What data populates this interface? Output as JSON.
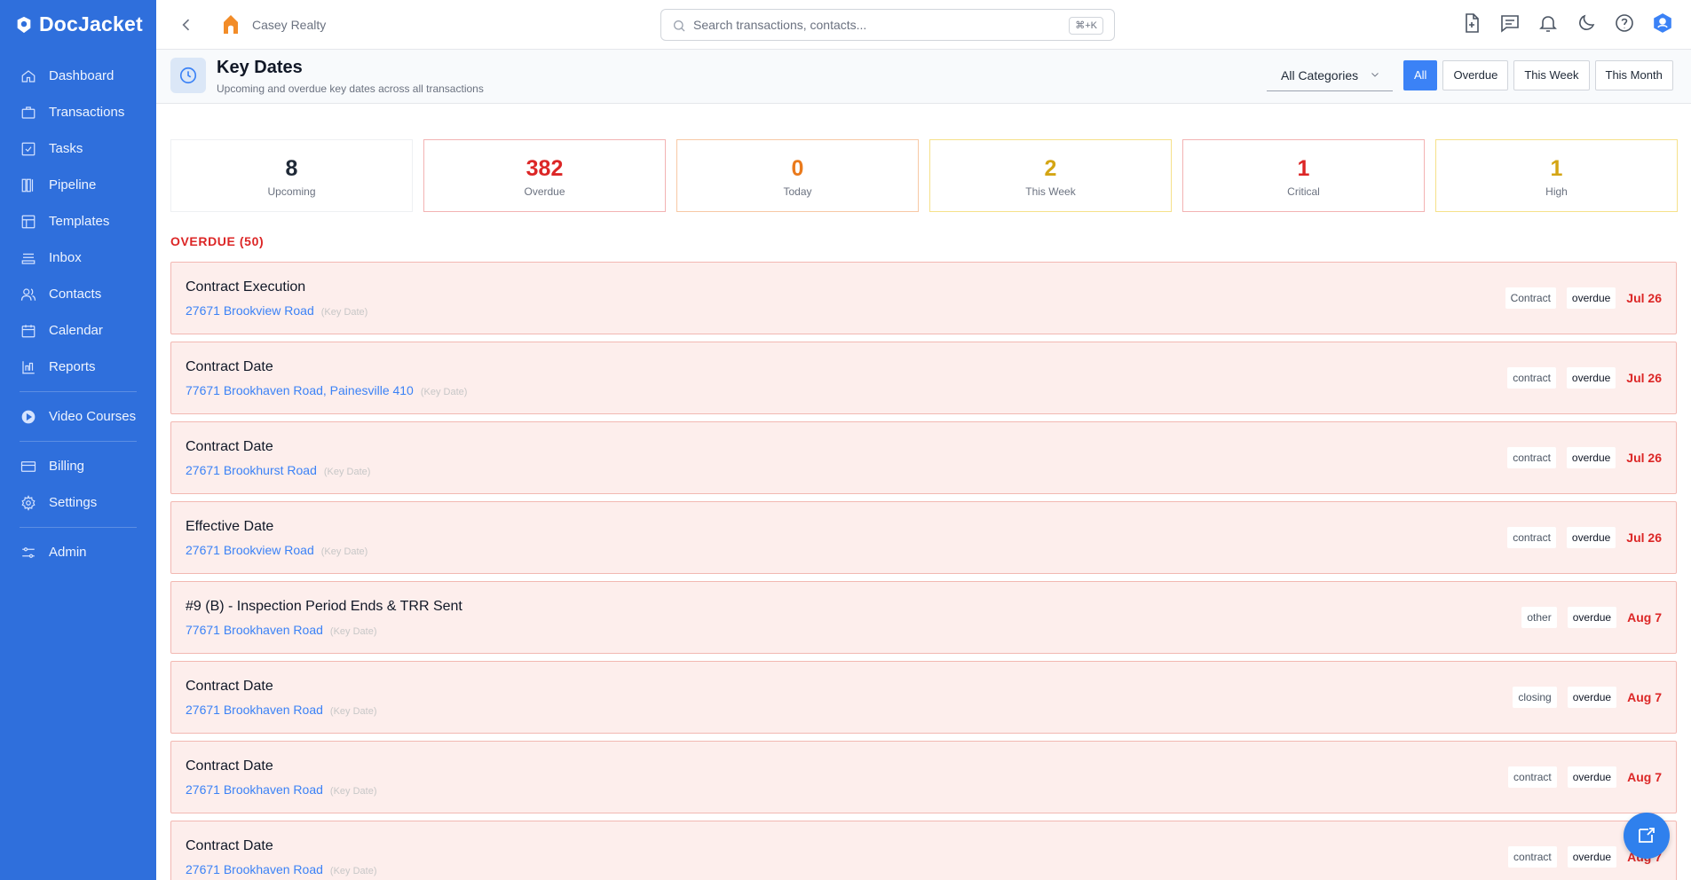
{
  "brand": {
    "name": "DocJacket"
  },
  "sidebar": {
    "items": [
      {
        "label": "Dashboard",
        "icon": "home-icon"
      },
      {
        "label": "Transactions",
        "icon": "briefcase-icon"
      },
      {
        "label": "Tasks",
        "icon": "check-square-icon"
      },
      {
        "label": "Pipeline",
        "icon": "columns-icon"
      },
      {
        "label": "Templates",
        "icon": "template-icon"
      },
      {
        "label": "Inbox",
        "icon": "inbox-icon"
      },
      {
        "label": "Contacts",
        "icon": "users-icon"
      },
      {
        "label": "Calendar",
        "icon": "calendar-icon"
      },
      {
        "label": "Reports",
        "icon": "bar-chart-icon"
      },
      {
        "label": "Video Courses",
        "icon": "play-circle-icon"
      },
      {
        "label": "Billing",
        "icon": "credit-card-icon"
      },
      {
        "label": "Settings",
        "icon": "gear-icon"
      },
      {
        "label": "Admin",
        "icon": "sliders-icon"
      }
    ]
  },
  "topbar": {
    "org_name": "Casey Realty",
    "search_placeholder": "Search transactions, contacts...",
    "search_shortcut": "⌘+K"
  },
  "header": {
    "title": "Key Dates",
    "subtitle": "Upcoming and overdue key dates across all transactions",
    "category_select": "All Categories",
    "filters": [
      "All",
      "Overdue",
      "This Week",
      "This Month"
    ],
    "active_filter": "All"
  },
  "stats": [
    {
      "value": "8",
      "label": "Upcoming",
      "color": "#1f2937"
    },
    {
      "value": "382",
      "label": "Overdue",
      "color": "#dc2626"
    },
    {
      "value": "0",
      "label": "Today",
      "color": "#ea7a1c"
    },
    {
      "value": "2",
      "label": "This Week",
      "color": "#d4a514"
    },
    {
      "value": "1",
      "label": "Critical",
      "color": "#dc2626"
    },
    {
      "value": "1",
      "label": "High",
      "color": "#d4a514"
    }
  ],
  "overdue_section": {
    "title": "OVERDUE (50)"
  },
  "rows": [
    {
      "title": "Contract Execution",
      "address": "27671 Brookview Road",
      "kind": "(Key Date)",
      "category": "Contract",
      "status": "overdue",
      "date": "Jul 26"
    },
    {
      "title": "Contract Date",
      "address": "77671 Brookhaven Road, Painesville 410",
      "kind": "(Key Date)",
      "category": "contract",
      "status": "overdue",
      "date": "Jul 26"
    },
    {
      "title": "Contract Date",
      "address": "27671 Brookhurst Road",
      "kind": "(Key Date)",
      "category": "contract",
      "status": "overdue",
      "date": "Jul 26"
    },
    {
      "title": "Effective Date",
      "address": "27671 Brookview Road",
      "kind": "(Key Date)",
      "category": "contract",
      "status": "overdue",
      "date": "Jul 26"
    },
    {
      "title": "#9 (B) - Inspection Period Ends & TRR Sent",
      "address": "77671 Brookhaven Road",
      "kind": "(Key Date)",
      "category": "other",
      "status": "overdue",
      "date": "Aug 7"
    },
    {
      "title": "Contract Date",
      "address": "27671 Brookhaven Road",
      "kind": "(Key Date)",
      "category": "closing",
      "status": "overdue",
      "date": "Aug 7"
    },
    {
      "title": "Contract Date",
      "address": "27671 Brookhaven Road",
      "kind": "(Key Date)",
      "category": "contract",
      "status": "overdue",
      "date": "Aug 7"
    },
    {
      "title": "Contract Date",
      "address": "27671 Brookhaven Road",
      "kind": "(Key Date)",
      "category": "contract",
      "status": "overdue",
      "date": "Aug 7"
    }
  ],
  "colors": {
    "sidebar": "#2f6fdc",
    "accent": "#3b82f6",
    "overdue": "#dc2626",
    "row_bg": "#fdeeec"
  }
}
